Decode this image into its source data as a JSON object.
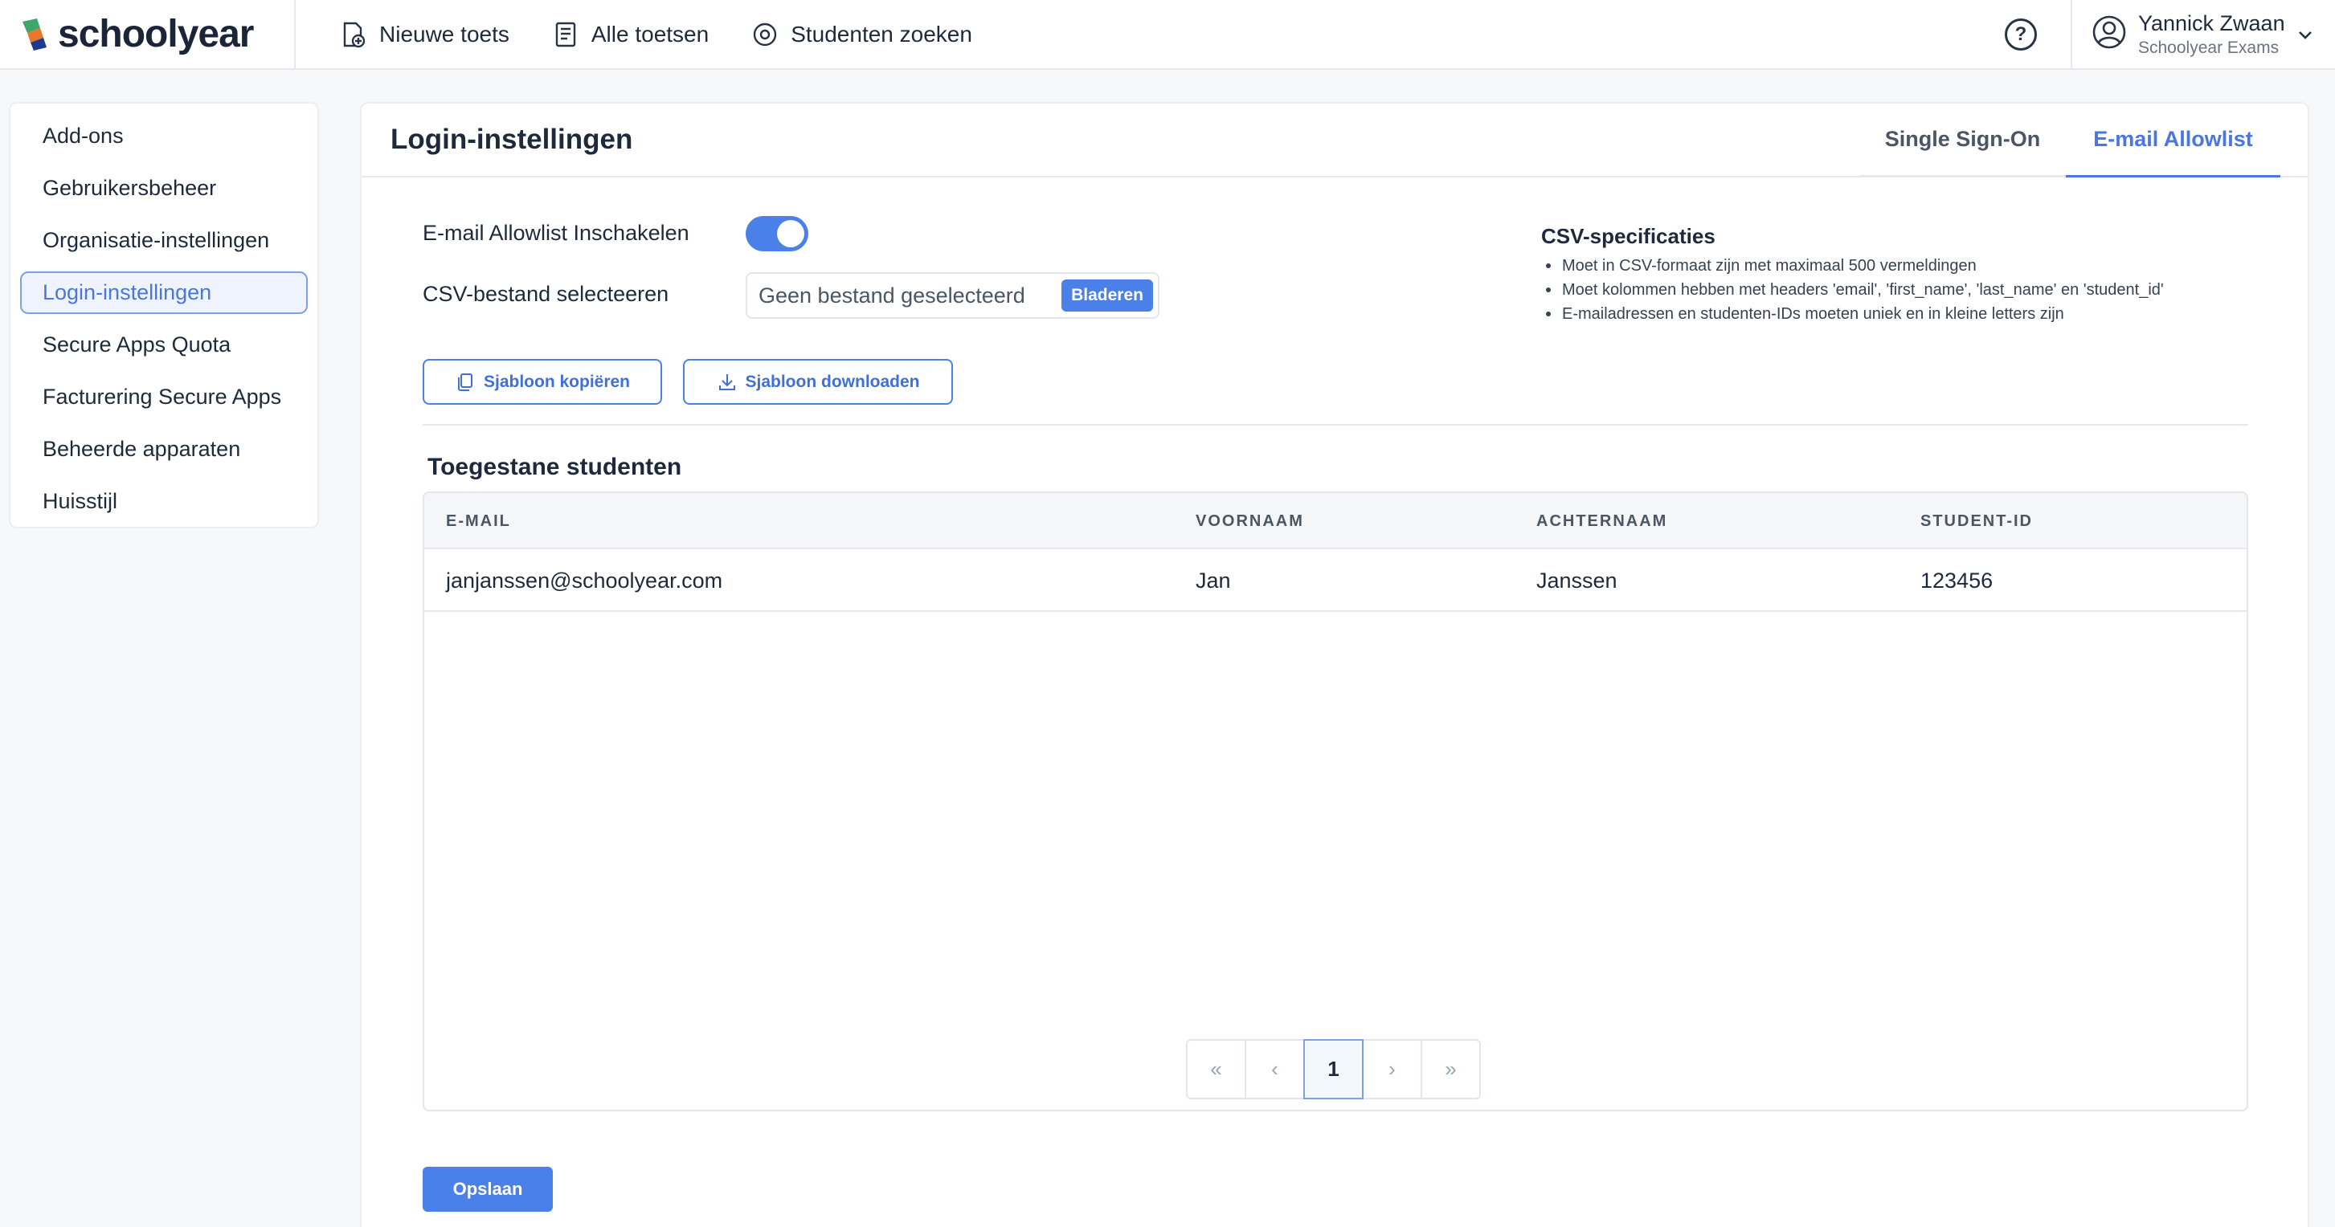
{
  "app": {
    "brand_name": "schoolyear"
  },
  "topnav": {
    "items": [
      {
        "label": "Nieuwe toets",
        "icon": "new-exam-icon"
      },
      {
        "label": "Alle toetsen",
        "icon": "document-list-icon"
      },
      {
        "label": "Studenten zoeken",
        "icon": "at-search-icon"
      }
    ]
  },
  "user": {
    "name": "Yannick Zwaan",
    "org": "Schoolyear Exams"
  },
  "sidebar": {
    "items": [
      {
        "label": "Add-ons"
      },
      {
        "label": "Gebruikersbeheer"
      },
      {
        "label": "Organisatie-instellingen"
      },
      {
        "label": "Login-instellingen",
        "active": true
      },
      {
        "label": "Secure Apps Quota"
      },
      {
        "label": "Facturering Secure Apps"
      },
      {
        "label": "Beheerde apparaten"
      },
      {
        "label": "Huisstijl"
      }
    ]
  },
  "page": {
    "title": "Login-instellingen",
    "tabs": [
      {
        "label": "Single Sign-On",
        "active": false
      },
      {
        "label": "E-mail Allowlist",
        "active": true
      }
    ]
  },
  "form": {
    "toggle_label": "E-mail Allowlist Inschakelen",
    "toggle_on": true,
    "csv_label": "CSV-bestand selecteeren",
    "file_placeholder": "Geen bestand geselecteerd",
    "browse_label": "Bladeren",
    "copy_template_label": "Sjabloon kopiëren",
    "download_template_label": "Sjabloon downloaden"
  },
  "specs": {
    "title": "CSV-specificaties",
    "items": [
      "Moet in CSV-formaat zijn met maximaal 500 vermeldingen",
      "Moet kolommen hebben met headers 'email', 'first_name', 'last_name' en 'student_id'",
      "E-mailadressen en studenten-IDs moeten uniek en in kleine letters zijn"
    ]
  },
  "table": {
    "title": "Toegestane studenten",
    "columns": [
      "E-MAIL",
      "VOORNAAM",
      "ACHTERNAAM",
      "STUDENT-ID"
    ],
    "rows": [
      [
        "janjanssen@schoolyear.com",
        "Jan",
        "Janssen",
        "123456"
      ]
    ]
  },
  "pagination": {
    "first": "«",
    "prev": "‹",
    "current": "1",
    "next": "›",
    "last": "»"
  },
  "actions": {
    "save_label": "Opslaan"
  },
  "colors": {
    "accent": "#4a80e8",
    "text": "#1e2a3b",
    "brand_green": "#3fa66a",
    "brand_orange": "#e8762d"
  }
}
